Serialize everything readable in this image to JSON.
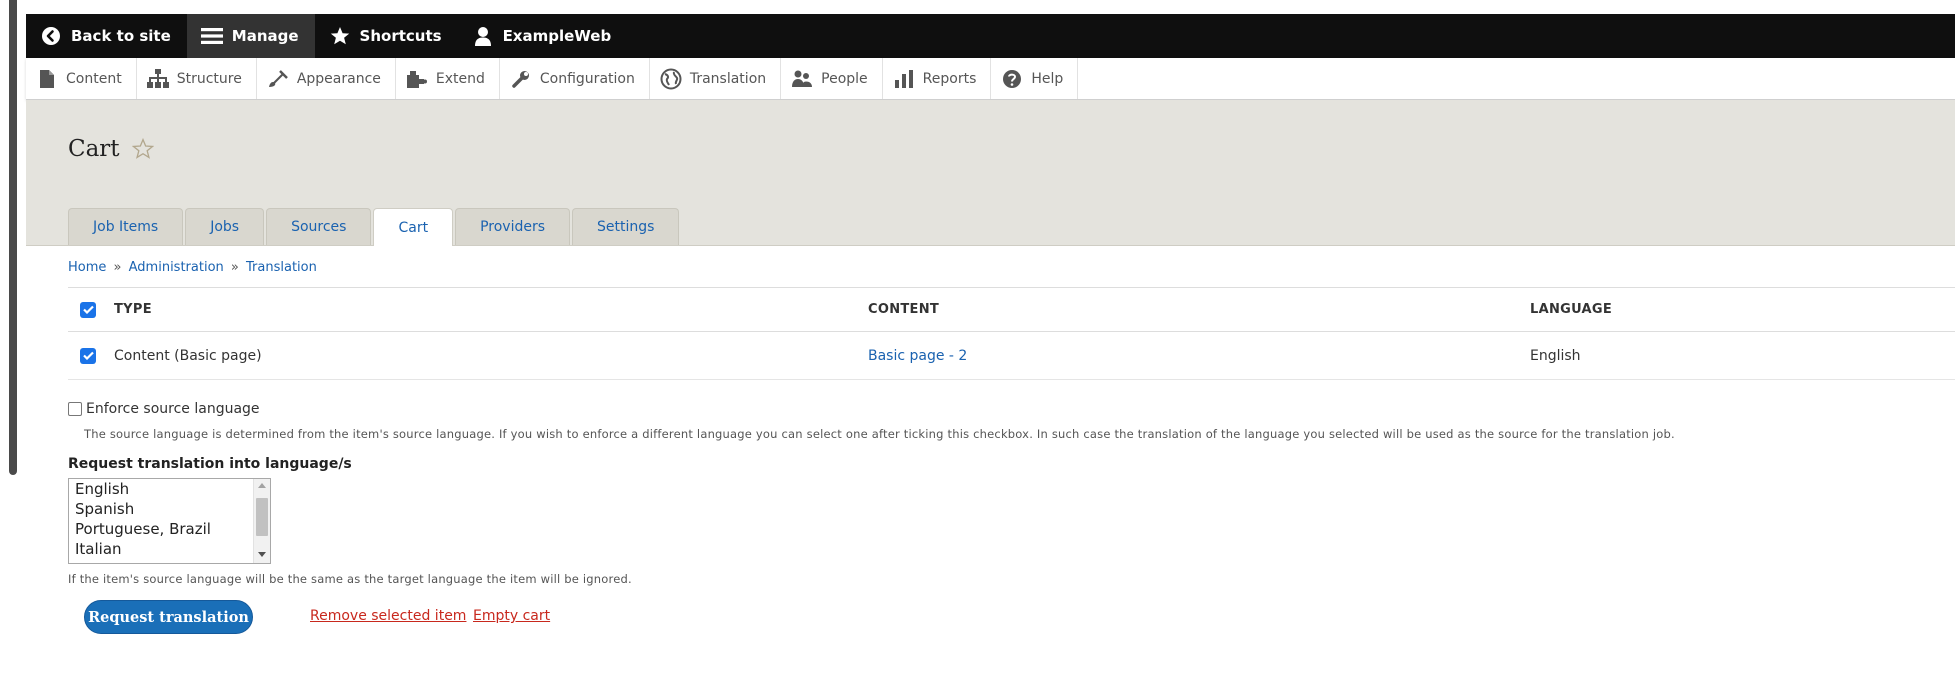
{
  "toolbar": {
    "back_label": "Back to site",
    "manage_label": "Manage",
    "shortcuts_label": "Shortcuts",
    "user_label": "ExampleWeb"
  },
  "admin_menu": [
    {
      "label": "Content",
      "icon": "file-icon"
    },
    {
      "label": "Structure",
      "icon": "sitemap-icon"
    },
    {
      "label": "Appearance",
      "icon": "brush-icon"
    },
    {
      "label": "Extend",
      "icon": "puzzle-icon"
    },
    {
      "label": "Configuration",
      "icon": "wrench-icon"
    },
    {
      "label": "Translation",
      "icon": "globe-icon"
    },
    {
      "label": "People",
      "icon": "people-icon"
    },
    {
      "label": "Reports",
      "icon": "bar-chart-icon"
    },
    {
      "label": "Help",
      "icon": "help-icon"
    }
  ],
  "page": {
    "title": "Cart",
    "tabs": [
      {
        "label": "Job Items",
        "active": false
      },
      {
        "label": "Jobs",
        "active": false
      },
      {
        "label": "Sources",
        "active": false
      },
      {
        "label": "Cart",
        "active": true
      },
      {
        "label": "Providers",
        "active": false
      },
      {
        "label": "Settings",
        "active": false
      }
    ]
  },
  "breadcrumb": {
    "home": "Home",
    "administration": "Administration",
    "translation": "Translation",
    "separator": "»"
  },
  "table": {
    "headers": {
      "type": "TYPE",
      "content": "CONTENT",
      "language": "LANGUAGE"
    },
    "rows": [
      {
        "type": "Content (Basic page)",
        "content": "Basic page - 2",
        "language": "English",
        "checked": true
      }
    ]
  },
  "form": {
    "enforce_label": "Enforce source language",
    "enforce_description": "The source language is determined from the item's source language. If you wish to enforce a different language you can select one after ticking this checkbox. In such case the translation of the language you selected will be used as the source for the translation job.",
    "request_label": "Request translation into language/s",
    "languages": [
      "English",
      "Spanish",
      "Portuguese, Brazil",
      "Italian"
    ],
    "target_note": "If the item's source language will be the same as the target language the item will be ignored.",
    "request_button": "Request translation",
    "remove_link": "Remove selected item",
    "empty_link": "Empty cart"
  },
  "colors": {
    "toolbar_bg": "#0f0f0f",
    "header_bg": "#e4e3dd",
    "link": "#1a62b0",
    "primary_button": "#1a6fb8",
    "danger_link": "#c8281d",
    "checkbox": "#1a73e8"
  }
}
